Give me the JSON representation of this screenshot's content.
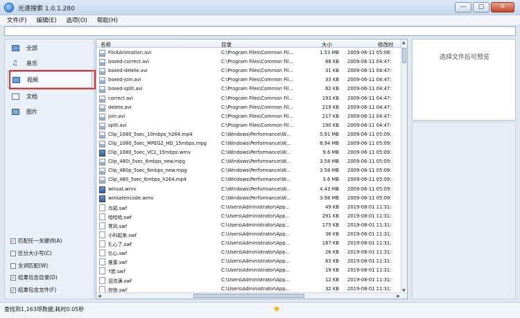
{
  "window": {
    "title": "光速搜索 1.0.1.280",
    "min": "—",
    "max": "▢",
    "close": "✕"
  },
  "menu": [
    "文件(F)",
    "编辑(E)",
    "选项(O)",
    "帮助(H)"
  ],
  "categories": [
    {
      "label": "全部",
      "icon": "all-icon"
    },
    {
      "label": "音乐",
      "icon": "music-icon"
    },
    {
      "label": "视频",
      "icon": "video-icon",
      "selected": true
    },
    {
      "label": "文档",
      "icon": "document-icon"
    },
    {
      "label": "图片",
      "icon": "picture-icon"
    }
  ],
  "options": [
    {
      "label": "匹配任一关键词(A)",
      "checked": true
    },
    {
      "label": "区分大小写(C)",
      "checked": false
    },
    {
      "label": "全词匹配(W)",
      "checked": false
    },
    {
      "label": "结果包含目录(D)",
      "checked": true
    },
    {
      "label": "结果包含文件(F)",
      "checked": true
    }
  ],
  "table": {
    "headers": {
      "name": "名称",
      "dir": "目录",
      "size": "大小",
      "modified": "修改时"
    },
    "rows": [
      [
        "FlickAnimation.avi",
        "C:\\Program Files\\Common Fil...",
        "1.53 MB",
        "2009-06-11 05:08:",
        "video"
      ],
      [
        "boxed-correct.avi",
        "C:\\Program Files\\Common Fil...",
        "88 KB",
        "2009-06-11 04:47:",
        "video"
      ],
      [
        "boxed-delete.avi",
        "C:\\Program Files\\Common Fil...",
        "31 KB",
        "2009-06-11 04:47:",
        "video"
      ],
      [
        "boxed-join.avi",
        "C:\\Program Files\\Common Fil...",
        "33 KB",
        "2009-06-11 04:47:",
        "video"
      ],
      [
        "boxed-split.avi",
        "C:\\Program Files\\Common Fil...",
        "62 KB",
        "2009-06-11 04:47:",
        "video"
      ],
      [
        "correct.avi",
        "C:\\Program Files\\Common Fil...",
        "193 KB",
        "2009-06-11 04:47:",
        "video"
      ],
      [
        "delete.avi",
        "C:\\Program Files\\Common Fil...",
        "219 KB",
        "2009-06-11 04:47:",
        "video"
      ],
      [
        "join.avi",
        "C:\\Program Files\\Common Fil...",
        "217 KB",
        "2009-06-11 04:47:",
        "video"
      ],
      [
        "split.avi",
        "C:\\Program Files\\Common Fil...",
        "190 KB",
        "2009-06-11 04:47:",
        "video"
      ],
      [
        "Clip_1080_5sec_10mbps_h264.mp4",
        "C:\\Windows\\Performance\\W...",
        "5.91 MB",
        "2009-06-11 05:09:",
        "video"
      ],
      [
        "Clip_1080_5sec_MPEG2_HD_15mbps.mpg",
        "C:\\Windows\\Performance\\W...",
        "8.94 MB",
        "2009-06-11 05:09:",
        "video"
      ],
      [
        "Clip_1080_5sec_VC1_15mbps.wmv",
        "C:\\Windows\\Performance\\W...",
        "9.6 MB",
        "2009-06-11 05:09:",
        "wmv"
      ],
      [
        "Clip_480i_5sec_6mbps_new.mpg",
        "C:\\Windows\\Performance\\W...",
        "3.58 MB",
        "2009-06-11 05:09:",
        "video"
      ],
      [
        "Clip_480p_5sec_6mbps_new.mpg",
        "C:\\Windows\\Performance\\W...",
        "3.58 MB",
        "2009-06-11 05:09:",
        "video"
      ],
      [
        "Clip_480_5sec_6mbps_h264.mp4",
        "C:\\Windows\\Performance\\W...",
        "3.6 MB",
        "2009-06-11 05:09:",
        "video"
      ],
      [
        "winsat.wmv",
        "C:\\Windows\\Performance\\W...",
        "4.43 MB",
        "2009-06-11 05:09:",
        "wmv"
      ],
      [
        "winsatencode.wmv",
        "C:\\Windows\\Performance\\W...",
        "3.98 MB",
        "2009-06-11 05:09:",
        "wmv"
      ],
      [
        "鸟鸦.swf",
        "C:\\Users\\Administrator\\App...",
        "49 KB",
        "2019-08-01 11:31:",
        "swf"
      ],
      [
        "哈哈哈.swf",
        "C:\\Users\\Administrator\\App...",
        "291 KB",
        "2019-08-01 11:31:",
        "swf"
      ],
      [
        "寒风.swf",
        "C:\\Users\\Administrator\\App...",
        "175 KB",
        "2019-08-01 11:31:",
        "swf"
      ],
      [
        "小科起来.swf",
        "C:\\Users\\Administrator\\App...",
        "36 KB",
        "2019-08-01 11:31:",
        "swf"
      ],
      [
        "扎心了.swf",
        "C:\\Users\\Administrator\\App...",
        "187 KB",
        "2019-08-01 11:31:",
        "swf"
      ],
      [
        "比心.swf",
        "C:\\Users\\Administrator\\App...",
        "26 KB",
        "2019-08-01 11:31:",
        "swf"
      ],
      [
        "推董.swf",
        "C:\\Users\\Administrator\\App...",
        "63 KB",
        "2019-08-01 11:31:",
        "swf"
      ],
      [
        "Y脸.swf",
        "C:\\Users\\Administrator\\App...",
        "19 KB",
        "2019-08-01 11:31:",
        "swf"
      ],
      [
        "泪流满.swf",
        "C:\\Users\\Administrator\\App...",
        "12 KB",
        "2019-08-01 11:31:",
        "swf"
      ],
      [
        "你快.swf",
        "C:\\Users\\Administrator\\App...",
        "32 KB",
        "2019-08-01 11:31:",
        "swf"
      ]
    ]
  },
  "preview": {
    "placeholder": "选择文件后可预览"
  },
  "status": {
    "text": "查找到1,163项数据,耗时0.05秒",
    "icon": "star-icon"
  }
}
